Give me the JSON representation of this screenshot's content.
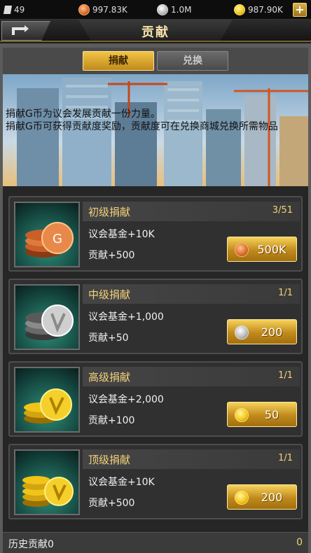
{
  "topbar": {
    "diamonds": "49",
    "bronze": "997.83K",
    "silver": "1.0M",
    "gold": "987.90K",
    "plus_label": "+"
  },
  "header": {
    "title": "贡献"
  },
  "tabs": [
    {
      "label": "捐献",
      "active": true
    },
    {
      "label": "兑换",
      "active": false
    }
  ],
  "banner": {
    "line1": "捐献G币为议会发展贡献一份力量。",
    "line2": "捐献G币可获得贡献度奖励，贡献度可在兑换商城兑换所需物品"
  },
  "cards": [
    {
      "name": "初级捐献",
      "count": "3/51",
      "fund": "议会基金+10K",
      "contrib": "贡献+500",
      "price": "500K",
      "coin": "bronze"
    },
    {
      "name": "中级捐献",
      "count": "1/1",
      "fund": "议会基金+1,000",
      "contrib": "贡献+50",
      "price": "200",
      "coin": "silver"
    },
    {
      "name": "高级捐献",
      "count": "1/1",
      "fund": "议会基金+2,000",
      "contrib": "贡献+100",
      "price": "50",
      "coin": "gold"
    },
    {
      "name": "顶级捐献",
      "count": "1/1",
      "fund": "议会基金+10K",
      "contrib": "贡献+500",
      "price": "200",
      "coin": "gold"
    }
  ],
  "footer": {
    "label": "历史贡献0",
    "value": "0"
  },
  "colors": {
    "gold_text": "#f3d27a",
    "button": "#c08a1c",
    "panel": "#262626"
  }
}
